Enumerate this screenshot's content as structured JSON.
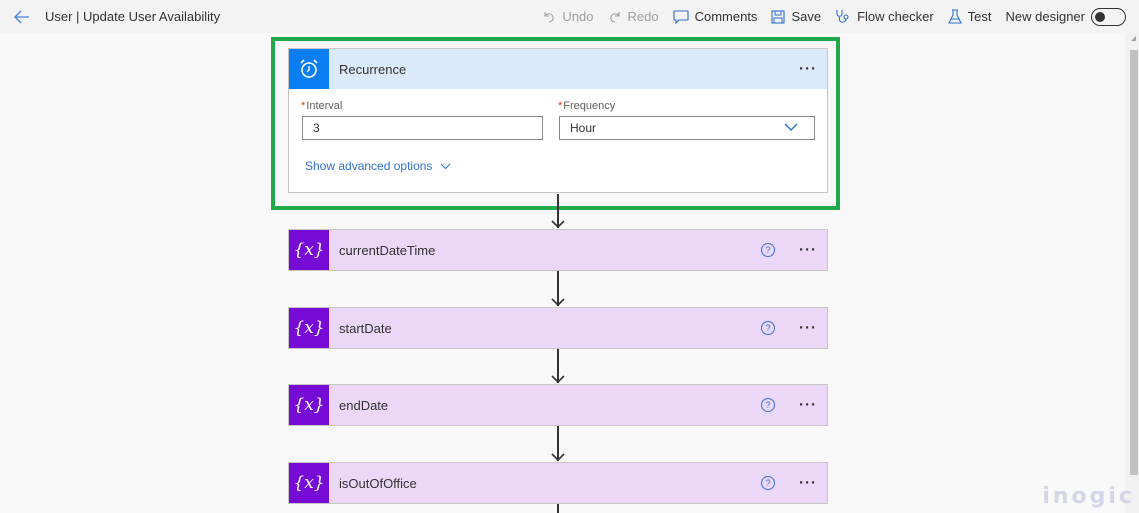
{
  "header": {
    "title": "User | Update User Availability",
    "back_icon": "arrow-left-icon"
  },
  "toolbar": {
    "undo": "Undo",
    "redo": "Redo",
    "comments": "Comments",
    "save": "Save",
    "flow_checker": "Flow checker",
    "test": "Test",
    "new_designer": "New designer",
    "new_designer_enabled": false
  },
  "trigger": {
    "title": "Recurrence",
    "icon": "alarm-clock-icon",
    "interval_label": "Interval",
    "interval_value": "3",
    "frequency_label": "Frequency",
    "frequency_value": "Hour",
    "advanced_link": "Show advanced options",
    "more": "…"
  },
  "actions": [
    {
      "title": "currentDateTime",
      "icon_text": "{x}"
    },
    {
      "title": "startDate",
      "icon_text": "{x}"
    },
    {
      "title": "endDate",
      "icon_text": "{x}"
    },
    {
      "title": "isOutOfOffice",
      "icon_text": "{x}"
    }
  ],
  "help_glyph": "?",
  "more_glyph": "···",
  "watermark": "inogic",
  "colors": {
    "highlight": "#21a84a",
    "trigger_accent": "#0a7ef2",
    "variable_accent": "#770bd6",
    "variable_bg": "#ebd8f9"
  }
}
